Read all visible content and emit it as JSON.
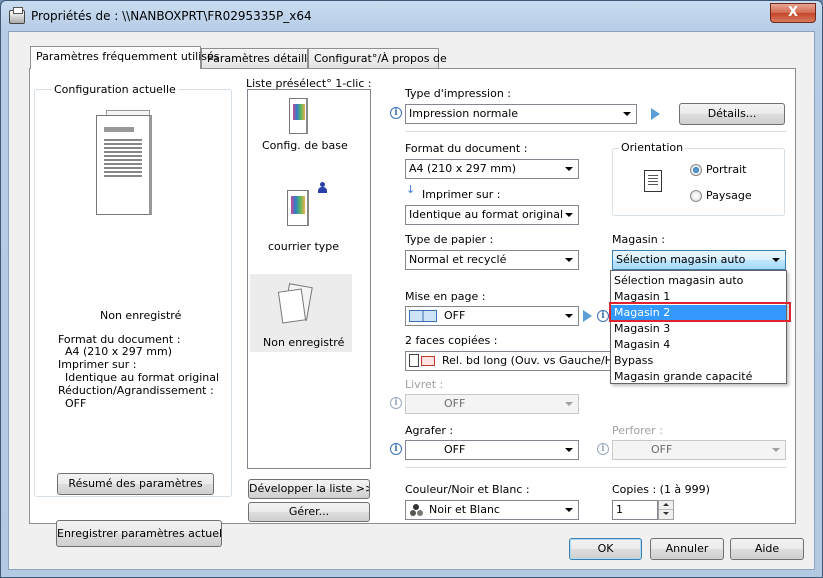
{
  "window": {
    "title": "Propriétés de : \\\\NANBOXPRT\\FR0295335P_x64",
    "close_symbol": "X"
  },
  "tabs": [
    {
      "label": "Paramètres fréquemment utilisés",
      "active": true
    },
    {
      "label": "Paramètres détaillés",
      "active": false
    },
    {
      "label": "Configurat°/À propos de",
      "active": false
    }
  ],
  "config": {
    "group_label": "Configuration actuelle",
    "status": "Non enregistré",
    "details": [
      "Format du document :",
      "  A4 (210 x 297 mm)",
      "Imprimer sur :",
      "  Identique au format original",
      "Réduction/Agrandissement :",
      "  OFF"
    ],
    "summary_button": "Résumé des paramètres",
    "save_button": "Enregistrer paramètres actuels..."
  },
  "presets": {
    "label": "Liste présélect° 1-clic :",
    "items": [
      {
        "label": "Config. de base"
      },
      {
        "label": "courrier type"
      },
      {
        "label": "Non enregistré"
      }
    ],
    "expand_button": "Développer la liste >>",
    "manage_button": "Gérer..."
  },
  "print_type": {
    "label": "Type d'impression :",
    "value": "Impression normale",
    "details_button": "Détails..."
  },
  "doc_format": {
    "label": "Format du document :",
    "value": "A4 (210 x 297 mm)"
  },
  "print_on": {
    "label": "Imprimer sur :",
    "value": "Identique au format original"
  },
  "orientation": {
    "label": "Orientation",
    "options": [
      "Portrait",
      "Paysage"
    ],
    "selected": "Portrait"
  },
  "paper_type": {
    "label": "Type de papier :",
    "value": "Normal et recyclé"
  },
  "tray": {
    "label": "Magasin :",
    "value": "Sélection magasin auto",
    "options": [
      "Sélection magasin auto",
      "Magasin 1",
      "Magasin 2",
      "Magasin 3",
      "Magasin 4",
      "Bypass",
      "Magasin grande capacité"
    ],
    "highlighted": "Magasin 2"
  },
  "layout": {
    "label": "Mise en page :",
    "value": "OFF"
  },
  "duplex": {
    "label": "2 faces copiées :",
    "value": "Rel. bd long (Ouv. vs Gauche/Haut)"
  },
  "booklet": {
    "label": "Livret :",
    "value": "OFF"
  },
  "staple": {
    "label": "Agrafer :",
    "value": "OFF"
  },
  "punch": {
    "label": "Perforer :",
    "value": "OFF"
  },
  "color": {
    "label": "Couleur/Noir et Blanc :",
    "value": "Noir et Blanc"
  },
  "copies": {
    "label": "Copies :  (1 à 999)",
    "value": "1"
  },
  "dialog_buttons": {
    "ok": "OK",
    "cancel": "Annuler",
    "help": "Aide"
  },
  "colors": {
    "selection": "#3399ff",
    "highlight_box": "#e0242f",
    "info_icon": "#3b6fb6"
  }
}
